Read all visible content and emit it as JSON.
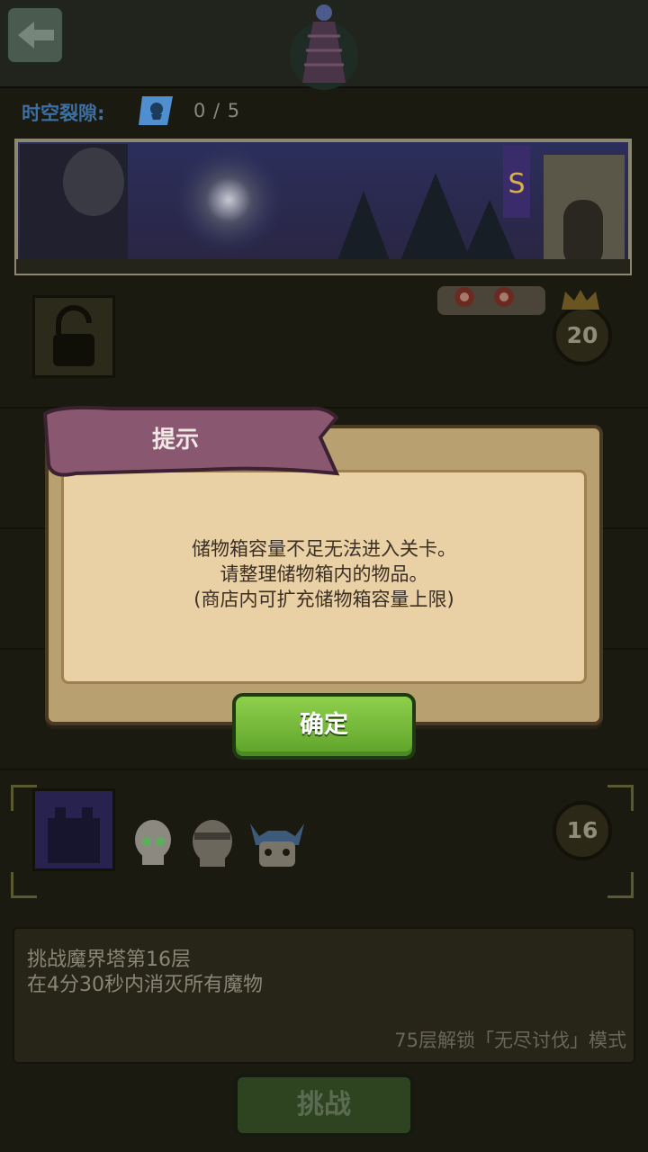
{
  "header": {
    "back_icon": "arrow-left-icon",
    "emblem_icon": "demon-tower-icon"
  },
  "rift": {
    "label": "时空裂隙:",
    "count": "0 / 5",
    "icon": "rift-scroll-icon"
  },
  "levels": [
    {
      "badge": "20",
      "locked": true
    },
    {
      "badge": "16",
      "selected": true
    }
  ],
  "description": {
    "title": "挑战魔界塔第16层",
    "objective": "在4分30秒内消灭所有魔物",
    "unlock_note": "75层解锁「无尽讨伐」模式"
  },
  "challenge_button": "挑战",
  "dialog": {
    "title": "提示",
    "lines": [
      "储物箱容量不足无法进入关卡。",
      "请整理储物箱内的物品。",
      "(商店内可扩充储物箱容量上限)"
    ],
    "ok_button": "确定"
  },
  "colors": {
    "dialog_parchment": "#ead0a5",
    "ribbon": "#8a5770",
    "ok_green": "#7cc03e",
    "rift_label": "#3c6fa2"
  }
}
